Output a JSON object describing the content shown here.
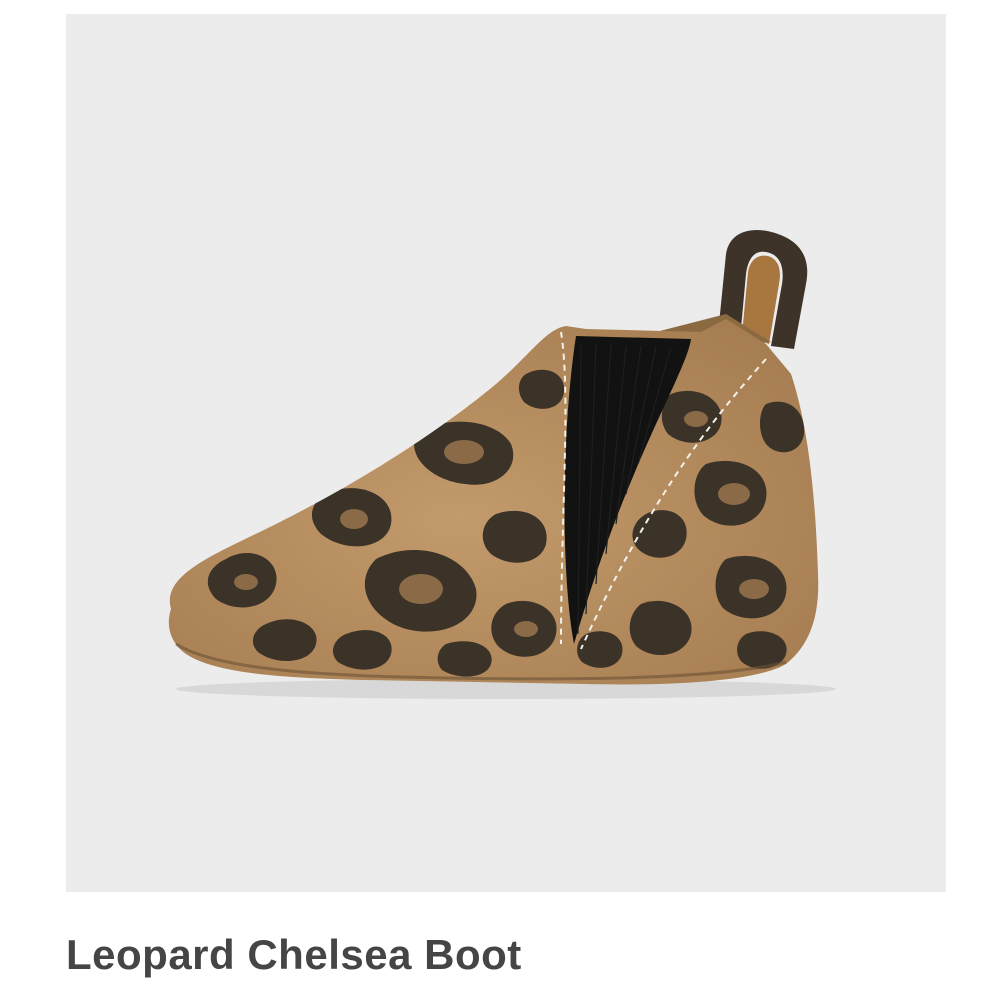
{
  "product": {
    "title": "Leopard Chelsea Boot",
    "image_subject": "leopard-print suede baby chelsea boot with black elastic side panel and pull tab",
    "colors": {
      "background": "#ececec",
      "suede_base": "#b48a5c",
      "spot_dark": "#3b3228",
      "spot_center": "#8a6a47",
      "elastic": "#121212",
      "title_text": "#454545"
    }
  }
}
